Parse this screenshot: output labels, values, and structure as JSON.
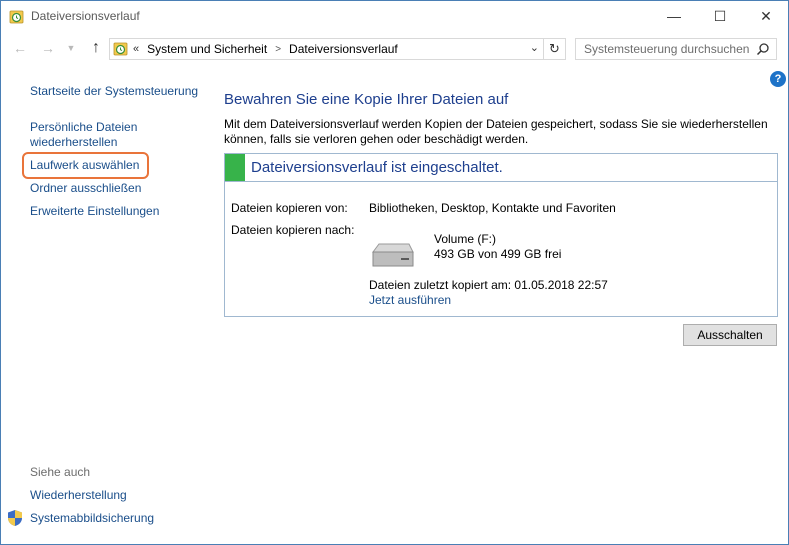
{
  "window": {
    "title": "Dateiversionsverlauf",
    "controls": {
      "minimize": "—",
      "maximize": "☐",
      "close": "✕"
    }
  },
  "address_bar": {
    "overflow": "«",
    "breadcrumbs": [
      {
        "label": "System und Sicherheit"
      },
      {
        "label": "Dateiversionsverlauf"
      }
    ],
    "separator": ">",
    "dropdown_icon": "chevron-down-icon",
    "refresh_icon": "refresh-icon"
  },
  "search": {
    "placeholder": "Systemsteuerung durchsuchen",
    "icon": "search-icon"
  },
  "help": {
    "label": "?"
  },
  "sidebar": {
    "home": "Startseite der Systemsteuerung",
    "restore": "Persönliche Dateien wiederherstellen",
    "select_drive": "Laufwerk auswählen",
    "exclude_folders": "Ordner ausschließen",
    "advanced": "Erweiterte Einstellungen",
    "see_also": "Siehe auch",
    "recovery": "Wiederherstellung",
    "system_image": "Systemabbildsicherung"
  },
  "main": {
    "heading": "Bewahren Sie eine Kopie Ihrer Dateien auf",
    "description": "Mit dem Dateiversionsverlauf werden Kopien der Dateien gespeichert, sodass Sie sie wiederherstellen können, falls sie verloren gehen oder beschädigt werden.",
    "status_title": "Dateiversionsverlauf ist eingeschaltet.",
    "status_color": "#37b34a",
    "copy_from_label": "Dateien kopieren von:",
    "copy_from_value": "Bibliotheken, Desktop, Kontakte und Favoriten",
    "copy_to_label": "Dateien kopieren nach:",
    "volume_name": "Volume (F:)",
    "volume_space": "493 GB von 499 GB frei",
    "last_copied": "Dateien zuletzt kopiert am: 01.05.2018 22:57",
    "run_now": "Jetzt ausführen",
    "turn_off_button": "Ausschalten"
  },
  "colors": {
    "link": "#1a4e8a",
    "heading": "#1e3f8e",
    "highlight": "#e9743a"
  }
}
